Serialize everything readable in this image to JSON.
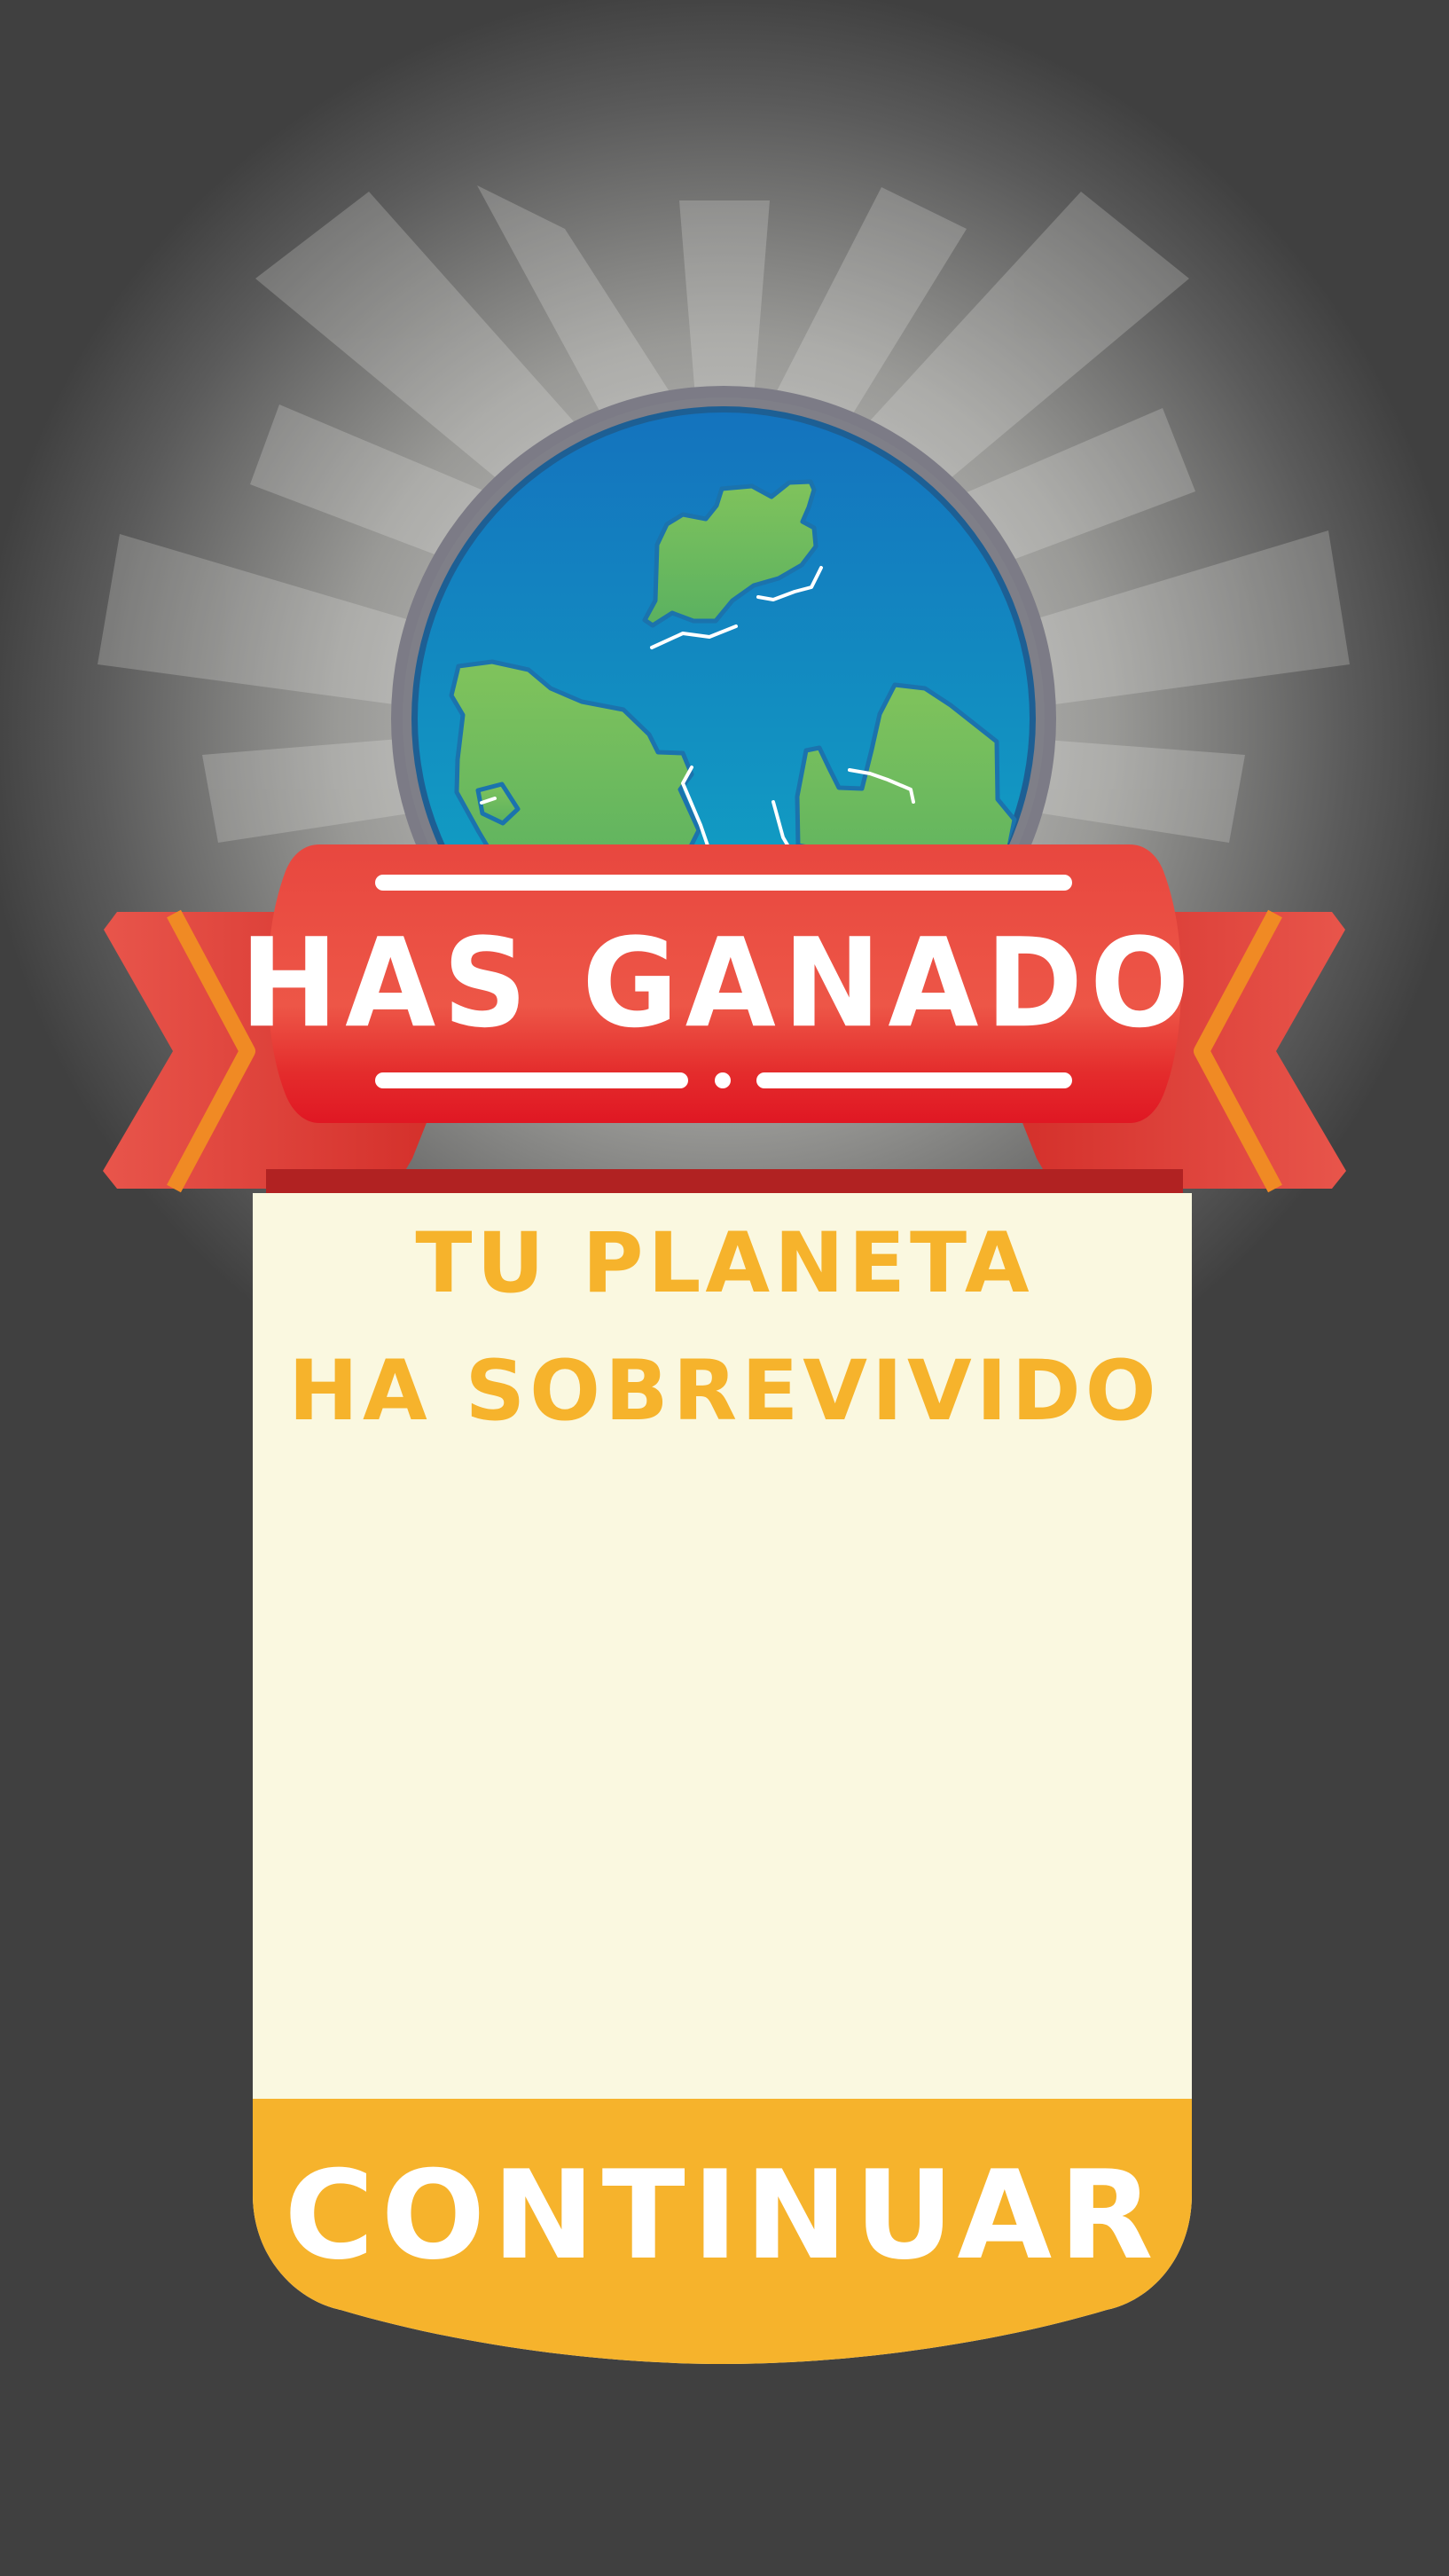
{
  "dialog": {
    "title": "HAS GANADO",
    "message": {
      "line1": "TU PLANETA",
      "line2": "HA SOBREVIVIDO"
    },
    "primary_button_label": "CONTINUAR"
  },
  "icons": {
    "globe": "globe-icon",
    "ribbon": "ribbon-banner-icon",
    "light_rays": "sunburst-rays-icon"
  },
  "colors": {
    "background": "#404040",
    "card": "#faf8e0",
    "accent_orange": "#f6b32c",
    "banner_red": "#e84b43",
    "ocean_blue": "#1788bf",
    "land_green": "#76bd5b"
  }
}
